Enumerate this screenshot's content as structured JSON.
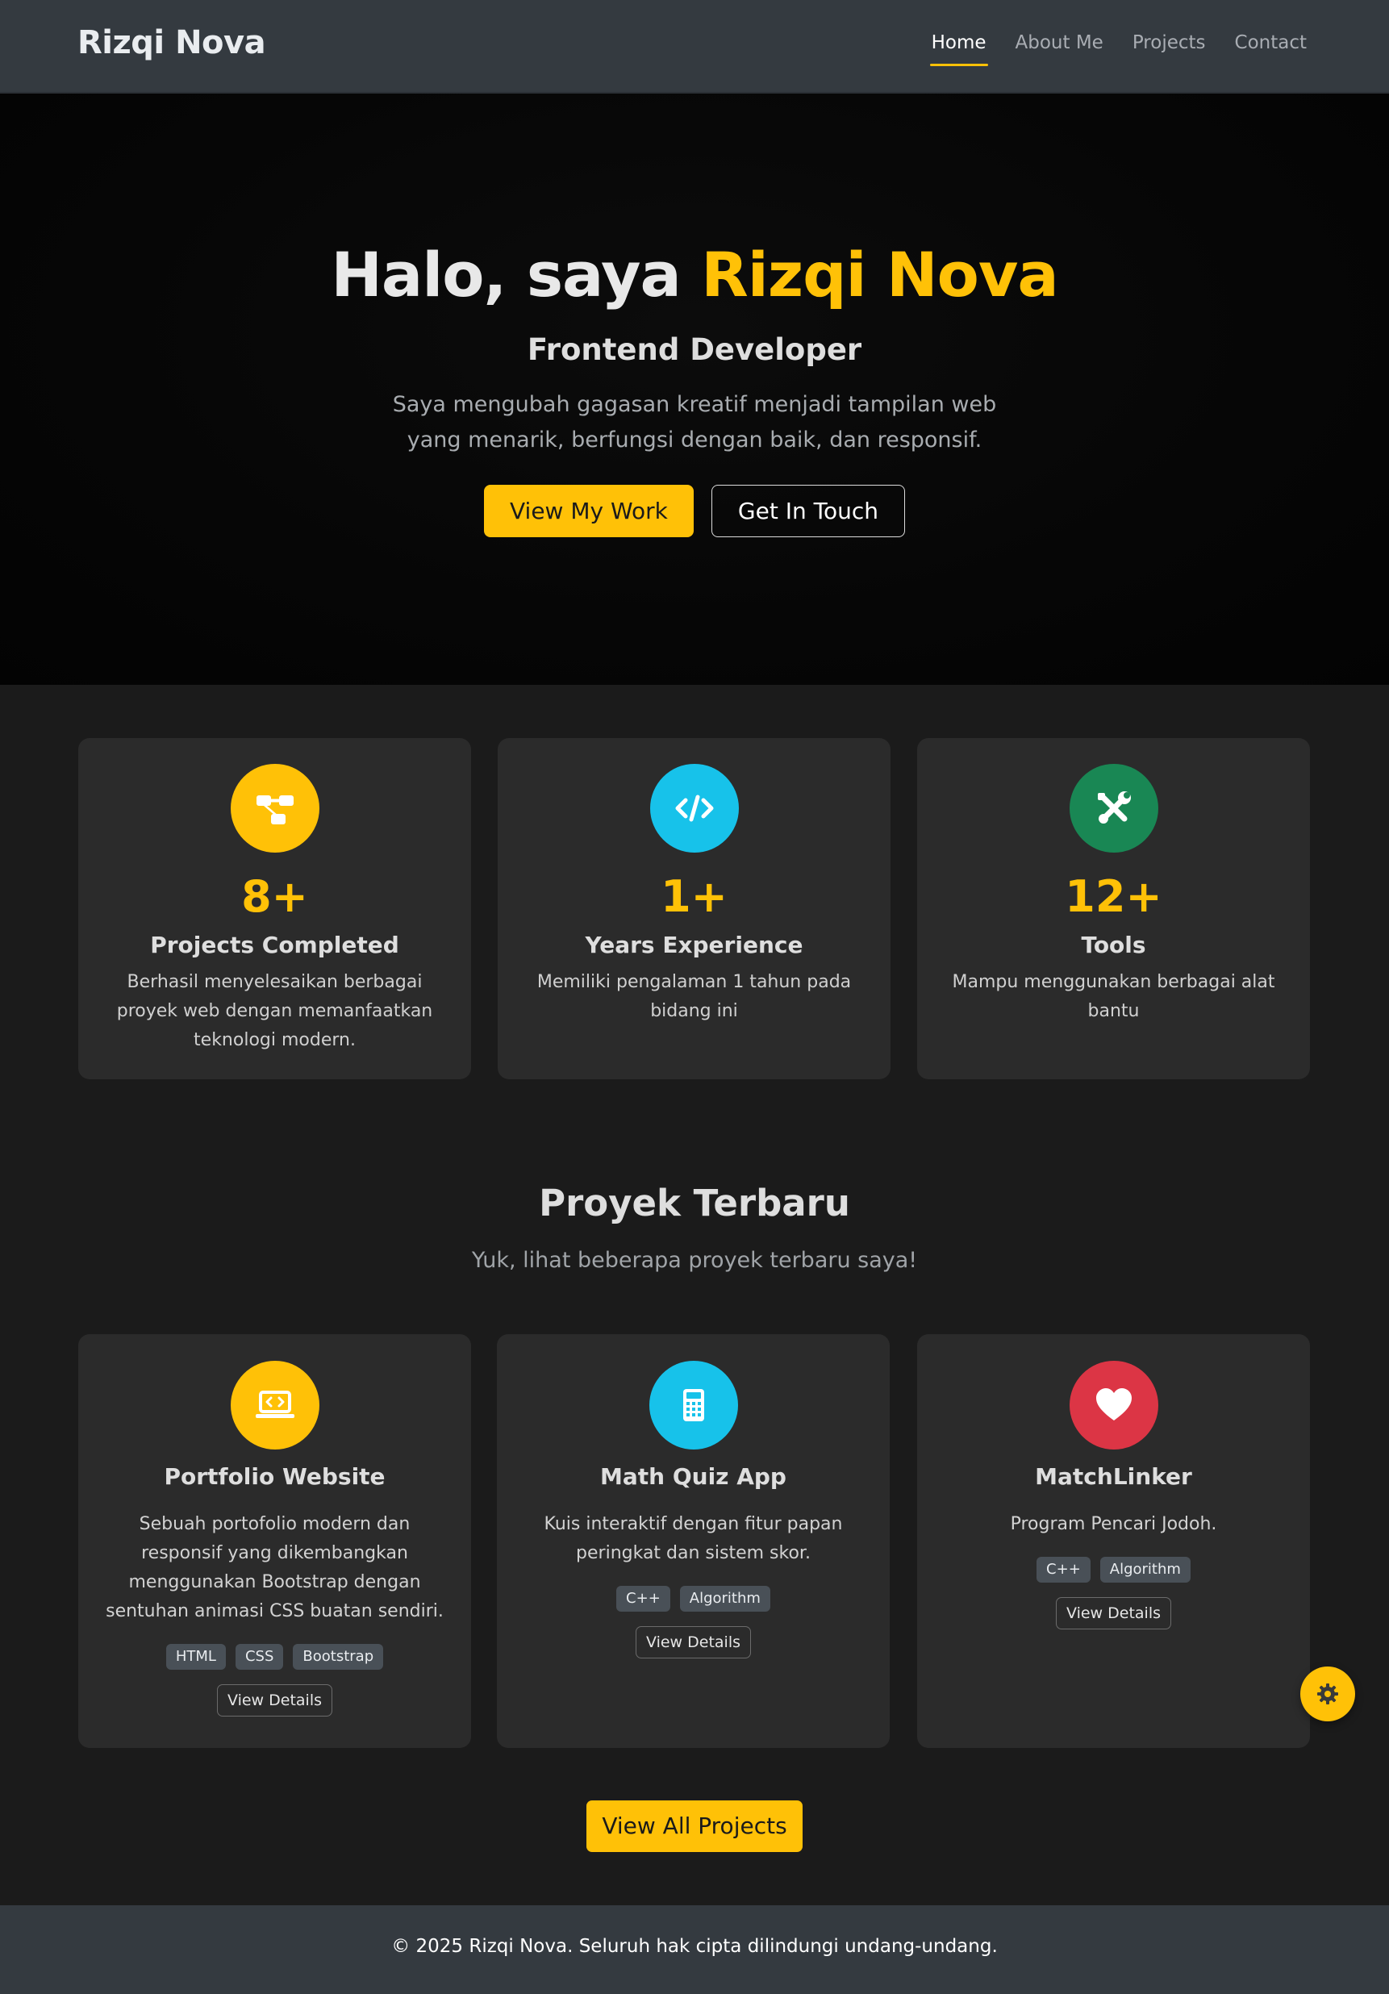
{
  "navbar": {
    "brand": "Rizqi Nova",
    "links": [
      {
        "label": "Home",
        "active": true
      },
      {
        "label": "About Me",
        "active": false
      },
      {
        "label": "Projects",
        "active": false
      },
      {
        "label": "Contact",
        "active": false
      }
    ]
  },
  "hero": {
    "title_prefix": "Halo, saya ",
    "title_name": "Rizqi Nova",
    "subtitle": "Frontend Developer",
    "description": "Saya mengubah gagasan kreatif menjadi tampilan web yang menarik, berfungsi dengan baik, dan responsif.",
    "primary_button": "View My Work",
    "secondary_button": "Get In Touch"
  },
  "stats": [
    {
      "icon": "diagram-icon",
      "color": "#ffc107",
      "number": "8+",
      "title": "Projects Completed",
      "description": "Berhasil menyelesaikan berbagai proyek web dengan memanfaatkan teknologi modern."
    },
    {
      "icon": "code-icon",
      "color": "#17c2ea",
      "number": "1+",
      "title": "Years Experience",
      "description": "Memiliki pengalaman 1 tahun pada bidang ini"
    },
    {
      "icon": "tools-icon",
      "color": "#198754",
      "number": "12+",
      "title": "Tools",
      "description": "Mampu menggunakan berbagai alat bantu"
    }
  ],
  "projects_section": {
    "title": "Proyek Terbaru",
    "subtitle": "Yuk, lihat beberapa proyek terbaru saya!",
    "projects": [
      {
        "icon": "laptop-code-icon",
        "color": "#ffc107",
        "title": "Portfolio Website",
        "description": "Sebuah portofolio modern dan responsif yang dikembangkan menggunakan Bootstrap dengan sentuhan animasi CSS buatan sendiri.",
        "tags": [
          "HTML",
          "CSS",
          "Bootstrap"
        ],
        "button": "View Details"
      },
      {
        "icon": "calculator-icon",
        "color": "#17c2ea",
        "title": "Math Quiz App",
        "description": "Kuis interaktif dengan fitur papan peringkat dan sistem skor.",
        "tags": [
          "C++",
          "Algorithm"
        ],
        "button": "View Details"
      },
      {
        "icon": "heart-icon",
        "color": "#dc3545",
        "title": "MatchLinker",
        "description": "Program Pencari Jodoh.",
        "tags": [
          "C++",
          "Algorithm"
        ],
        "button": "View Details"
      }
    ],
    "view_all_button": "View All Projects"
  },
  "theme_toggle": {
    "icon": "gear-icon"
  },
  "footer": {
    "text": "© 2025 Rizqi Nova. Seluruh hak cipta dilindungi undang-undang."
  }
}
